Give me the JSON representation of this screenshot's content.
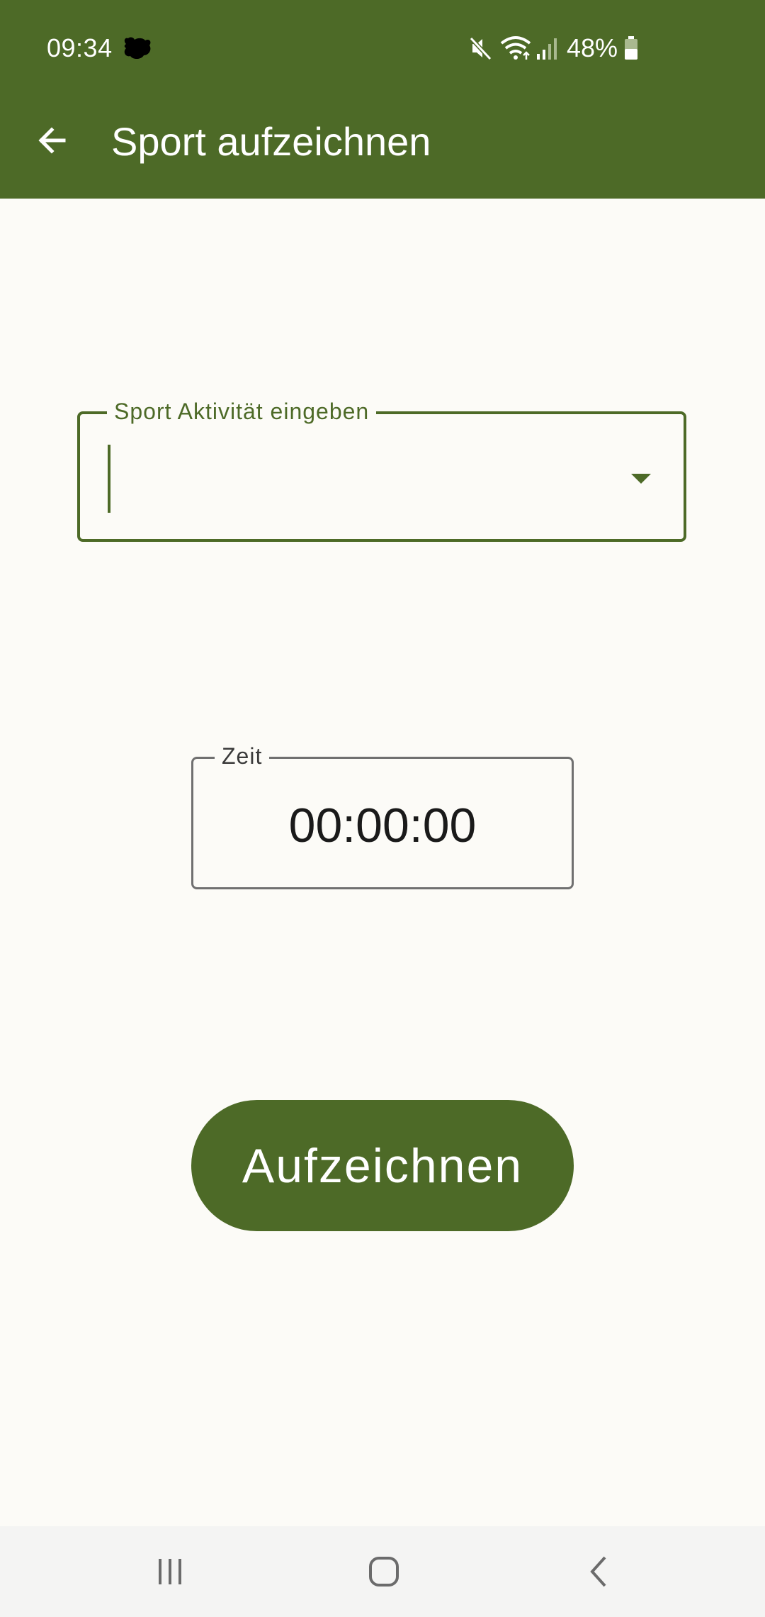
{
  "status_bar": {
    "time": "09:34",
    "battery_percent": "48%",
    "icons": [
      "notification-app-icon",
      "mute-icon",
      "wifi-icon",
      "signal-icon",
      "battery-icon"
    ],
    "battery_level": 0.48
  },
  "app_bar": {
    "title": "Sport aufzeichnen",
    "back_icon": "arrow-left-icon"
  },
  "form": {
    "activity_label": "Sport Aktivität eingeben",
    "activity_value": "",
    "time_label": "Zeit",
    "time_value": "00:00:00",
    "record_button_label": "Aufzeichnen"
  },
  "nav_bar": {
    "buttons": [
      "recent-apps-icon",
      "home-icon",
      "back-icon"
    ]
  },
  "colors": {
    "primary": "#4d6a27",
    "background": "#fcfbf7",
    "time_border": "#707070",
    "nav_background": "#f4f4f3"
  }
}
